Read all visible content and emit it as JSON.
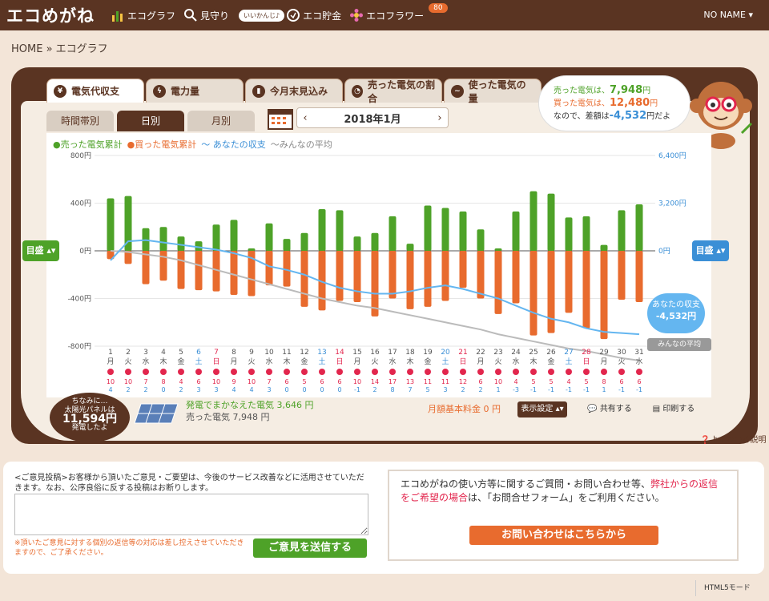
{
  "app": {
    "logo": "エコめがね",
    "user": "NO NAME ▾"
  },
  "nav": [
    {
      "label": "エコグラフ",
      "icon": "bar-chart-icon"
    },
    {
      "label": "見守り",
      "icon": "magnifier-icon"
    },
    {
      "label": "エコ貯金",
      "icon": "coin-icon"
    },
    {
      "label": "エコフラワー",
      "icon": "flower-icon"
    }
  ],
  "nav_tag": "いいかんじ♪",
  "nav_badge": "80",
  "breadcrumb": "HOME » エコグラフ",
  "tabs": [
    "電気代収支",
    "電力量",
    "今月末見込み",
    "売った電気の割合",
    "使った電気の量"
  ],
  "subtabs": [
    "時間帯別",
    "日別",
    "月別"
  ],
  "month": "2018年1月",
  "summary": {
    "sold_label": "売った電気は、",
    "sold_value": "7,948",
    "yen": "円",
    "bought_label": "買った電気は、",
    "bought_value": "12,480",
    "diff_label": "なので、差額は",
    "diff_value": "-4,532",
    "diff_suffix": "円だよ"
  },
  "legend": [
    "●売った電気累計",
    "●買った電気累計",
    "〜 あなたの収支",
    "〜みんなの平均"
  ],
  "target_left": "目盛 ▴▾",
  "target_right": "目盛 ▴▾",
  "callout_you": [
    "あなたの収支",
    "-4,532円"
  ],
  "callout_avg": "みんなの平均",
  "solar_badge": [
    "ちなみに…",
    "太陽光パネルは",
    "11,594円",
    "発電したよ"
  ],
  "solar_text": [
    "発電でまかなえた電気 3,646 円",
    "売った電気 7,948 円"
  ],
  "fee": "月額基本料金 0 円",
  "buttons": {
    "display": "表示設定 ▴▾",
    "share": "共有する",
    "print": "印刷する"
  },
  "help": "よくわかる説明",
  "feedback": {
    "text": "<ご意見投稿>お客様から頂いたご意見・ご要望は、今後のサービス改善などに活用させていただきます。なお、公序良俗に反する投稿はお断りします。",
    "note": "※頂いたご意見に対する個別の返信等の対応は差し控えさせていただきますので、ご了承ください。",
    "send": "ご意見を送信する"
  },
  "contact": {
    "text1": "エコめがねの使い方等に関するご質問・お問い合わせ等、",
    "text_red": "弊社からの返信をご希望の場合",
    "text2": "は、「お問合せフォーム」をご利用ください。",
    "button": "お問い合わせはこちらから"
  },
  "html5": "HTML5モード",
  "colors": {
    "sold": "#4ea228",
    "bought": "#e86b2e",
    "mine": "#64b6f0",
    "avg": "#bbbbbb",
    "brown": "#5a3422"
  },
  "chart_data": {
    "type": "bar",
    "left_axis": {
      "ticks": [
        "800円",
        "400円",
        "0円",
        "-400円",
        "-800円"
      ],
      "ylim": [
        -800,
        800
      ]
    },
    "right_axis": {
      "ticks": [
        "6,400円",
        "3,200円",
        "0円",
        "-3,200円"
      ],
      "ylim": [
        -6400,
        6400
      ]
    },
    "days": [
      "1",
      "2",
      "3",
      "4",
      "5",
      "6",
      "7",
      "8",
      "9",
      "10",
      "11",
      "12",
      "13",
      "14",
      "15",
      "16",
      "17",
      "18",
      "19",
      "20",
      "21",
      "22",
      "23",
      "24",
      "25",
      "26",
      "27",
      "28",
      "29",
      "30",
      "31"
    ],
    "weekdays": [
      "月",
      "火",
      "水",
      "木",
      "金",
      "土",
      "日",
      "月",
      "火",
      "水",
      "木",
      "金",
      "土",
      "日",
      "月",
      "火",
      "水",
      "木",
      "金",
      "土",
      "日",
      "月",
      "火",
      "水",
      "木",
      "金",
      "土",
      "日",
      "月",
      "火",
      "水"
    ],
    "temp_high": [
      "10",
      "10",
      "7",
      "8",
      "4",
      "6",
      "10",
      "9",
      "10",
      "7",
      "6",
      "5",
      "6",
      "6",
      "10",
      "14",
      "17",
      "13",
      "11",
      "11",
      "12",
      "6",
      "10",
      "4",
      "5",
      "5",
      "4",
      "5",
      "8",
      "6",
      "6"
    ],
    "temp_low": [
      "4",
      "2",
      "2",
      "0",
      "2",
      "3",
      "3",
      "4",
      "4",
      "3",
      "0",
      "0",
      "0",
      "0",
      "-1",
      "2",
      "8",
      "7",
      "5",
      "3",
      "2",
      "2",
      "1",
      "-3",
      "-1",
      "-1",
      "-1",
      "-1",
      "1",
      "-1",
      "-1"
    ],
    "series": [
      {
        "name": "売った電気累計",
        "values": [
          440,
          460,
          190,
          200,
          120,
          80,
          220,
          260,
          20,
          230,
          100,
          150,
          350,
          340,
          120,
          150,
          290,
          60,
          380,
          360,
          330,
          180,
          20,
          330,
          500,
          480,
          280,
          290,
          50,
          340,
          390
        ]
      },
      {
        "name": "買った電気累計",
        "values": [
          -70,
          -110,
          -280,
          -250,
          -320,
          -330,
          -340,
          -370,
          -380,
          -290,
          -300,
          -470,
          -500,
          -420,
          -430,
          -550,
          -400,
          -490,
          -470,
          -420,
          -310,
          -400,
          -530,
          -440,
          -710,
          -690,
          -520,
          -650,
          -740,
          -410,
          -430
        ]
      }
    ],
    "mine_line": [
      -80,
      80,
      90,
      70,
      50,
      30,
      10,
      -20,
      -60,
      -130,
      -160,
      -200,
      -260,
      -310,
      -340,
      -360,
      -360,
      -340,
      -310,
      -290,
      -320,
      -360,
      -400,
      -460,
      -520,
      -570,
      -600,
      -650,
      -680,
      -690,
      -700
    ],
    "avg_line": [
      0,
      -10,
      -30,
      -50,
      -80,
      -120,
      -160,
      -200,
      -240,
      -280,
      -320,
      -360,
      -400,
      -430,
      -460,
      -480,
      -510,
      -540,
      -570,
      -600,
      -630,
      -660,
      -700,
      -730,
      -760,
      -790,
      -820,
      -840,
      -870,
      -900,
      -920
    ]
  }
}
